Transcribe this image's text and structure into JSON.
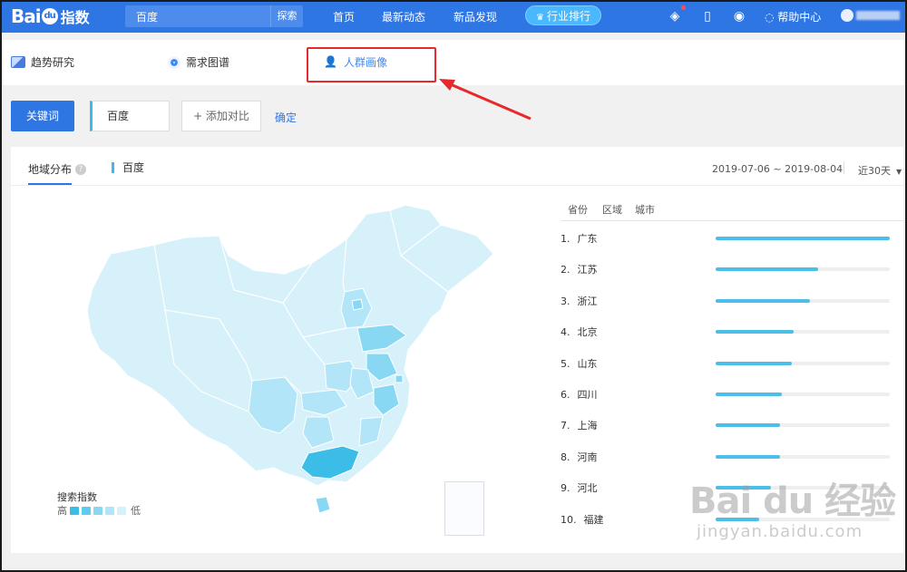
{
  "topbar": {
    "logo_main": "Bai",
    "logo_paw": "du",
    "logo_suffix": "指数",
    "search_value": "百度",
    "search_button": "探索",
    "nav": [
      "首页",
      "最新动态",
      "新品发现"
    ],
    "rank_button": "行业排行",
    "help": "帮助中心",
    "icons": [
      "diamond-icon",
      "tablet-icon",
      "wechat-icon",
      "chat-bubble-icon"
    ]
  },
  "subnav": {
    "tabs": [
      {
        "label": "趋势研究",
        "icon": "trend-chart-icon",
        "active": false
      },
      {
        "label": "需求图谱",
        "icon": "radar-icon",
        "active": false
      },
      {
        "label": "人群画像",
        "icon": "people-icon",
        "active": true
      }
    ]
  },
  "keyword_bar": {
    "label_button": "关键词",
    "keyword": "百度",
    "add_compare": "+ 添加对比",
    "confirm": "确定"
  },
  "panel": {
    "tab_label": "地域分布",
    "keyword_tag": "百度",
    "date_range": "2019-07-06 ~ 2019-08-04",
    "period": "近30天",
    "legend_title": "搜索指数",
    "legend_high": "高",
    "legend_low": "低",
    "legend_colors": [
      "#3bbde8",
      "#5fcbee",
      "#88d8f3",
      "#b2e5f7",
      "#d6f1fa"
    ],
    "ranking_headers": [
      "省份",
      "区域",
      "城市"
    ],
    "ranking": [
      {
        "rank": "1.",
        "name": "广东",
        "value": 1.0
      },
      {
        "rank": "2.",
        "name": "江苏",
        "value": 0.59
      },
      {
        "rank": "3.",
        "name": "浙江",
        "value": 0.54
      },
      {
        "rank": "4.",
        "name": "北京",
        "value": 0.45
      },
      {
        "rank": "5.",
        "name": "山东",
        "value": 0.44
      },
      {
        "rank": "6.",
        "name": "四川",
        "value": 0.38
      },
      {
        "rank": "7.",
        "name": "上海",
        "value": 0.37
      },
      {
        "rank": "8.",
        "name": "河南",
        "value": 0.37
      },
      {
        "rank": "9.",
        "name": "河北",
        "value": 0.32
      },
      {
        "rank": "10.",
        "name": "福建",
        "value": 0.25
      }
    ]
  },
  "watermark": {
    "logo": "Bai du 经验",
    "url": "jingyan.baidu.com"
  }
}
